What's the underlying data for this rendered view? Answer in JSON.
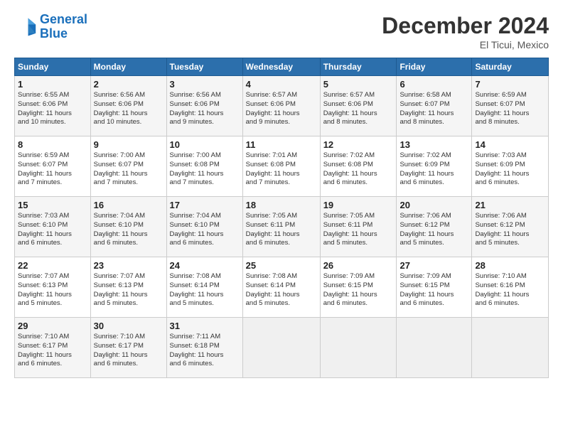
{
  "header": {
    "logo_line1": "General",
    "logo_line2": "Blue",
    "month": "December 2024",
    "location": "El Ticui, Mexico"
  },
  "weekdays": [
    "Sunday",
    "Monday",
    "Tuesday",
    "Wednesday",
    "Thursday",
    "Friday",
    "Saturday"
  ],
  "weeks": [
    [
      {
        "day": "1",
        "info": "Sunrise: 6:55 AM\nSunset: 6:06 PM\nDaylight: 11 hours\nand 10 minutes."
      },
      {
        "day": "2",
        "info": "Sunrise: 6:56 AM\nSunset: 6:06 PM\nDaylight: 11 hours\nand 10 minutes."
      },
      {
        "day": "3",
        "info": "Sunrise: 6:56 AM\nSunset: 6:06 PM\nDaylight: 11 hours\nand 9 minutes."
      },
      {
        "day": "4",
        "info": "Sunrise: 6:57 AM\nSunset: 6:06 PM\nDaylight: 11 hours\nand 9 minutes."
      },
      {
        "day": "5",
        "info": "Sunrise: 6:57 AM\nSunset: 6:06 PM\nDaylight: 11 hours\nand 8 minutes."
      },
      {
        "day": "6",
        "info": "Sunrise: 6:58 AM\nSunset: 6:07 PM\nDaylight: 11 hours\nand 8 minutes."
      },
      {
        "day": "7",
        "info": "Sunrise: 6:59 AM\nSunset: 6:07 PM\nDaylight: 11 hours\nand 8 minutes."
      }
    ],
    [
      {
        "day": "8",
        "info": "Sunrise: 6:59 AM\nSunset: 6:07 PM\nDaylight: 11 hours\nand 7 minutes."
      },
      {
        "day": "9",
        "info": "Sunrise: 7:00 AM\nSunset: 6:07 PM\nDaylight: 11 hours\nand 7 minutes."
      },
      {
        "day": "10",
        "info": "Sunrise: 7:00 AM\nSunset: 6:08 PM\nDaylight: 11 hours\nand 7 minutes."
      },
      {
        "day": "11",
        "info": "Sunrise: 7:01 AM\nSunset: 6:08 PM\nDaylight: 11 hours\nand 7 minutes."
      },
      {
        "day": "12",
        "info": "Sunrise: 7:02 AM\nSunset: 6:08 PM\nDaylight: 11 hours\nand 6 minutes."
      },
      {
        "day": "13",
        "info": "Sunrise: 7:02 AM\nSunset: 6:09 PM\nDaylight: 11 hours\nand 6 minutes."
      },
      {
        "day": "14",
        "info": "Sunrise: 7:03 AM\nSunset: 6:09 PM\nDaylight: 11 hours\nand 6 minutes."
      }
    ],
    [
      {
        "day": "15",
        "info": "Sunrise: 7:03 AM\nSunset: 6:10 PM\nDaylight: 11 hours\nand 6 minutes."
      },
      {
        "day": "16",
        "info": "Sunrise: 7:04 AM\nSunset: 6:10 PM\nDaylight: 11 hours\nand 6 minutes."
      },
      {
        "day": "17",
        "info": "Sunrise: 7:04 AM\nSunset: 6:10 PM\nDaylight: 11 hours\nand 6 minutes."
      },
      {
        "day": "18",
        "info": "Sunrise: 7:05 AM\nSunset: 6:11 PM\nDaylight: 11 hours\nand 6 minutes."
      },
      {
        "day": "19",
        "info": "Sunrise: 7:05 AM\nSunset: 6:11 PM\nDaylight: 11 hours\nand 5 minutes."
      },
      {
        "day": "20",
        "info": "Sunrise: 7:06 AM\nSunset: 6:12 PM\nDaylight: 11 hours\nand 5 minutes."
      },
      {
        "day": "21",
        "info": "Sunrise: 7:06 AM\nSunset: 6:12 PM\nDaylight: 11 hours\nand 5 minutes."
      }
    ],
    [
      {
        "day": "22",
        "info": "Sunrise: 7:07 AM\nSunset: 6:13 PM\nDaylight: 11 hours\nand 5 minutes."
      },
      {
        "day": "23",
        "info": "Sunrise: 7:07 AM\nSunset: 6:13 PM\nDaylight: 11 hours\nand 5 minutes."
      },
      {
        "day": "24",
        "info": "Sunrise: 7:08 AM\nSunset: 6:14 PM\nDaylight: 11 hours\nand 5 minutes."
      },
      {
        "day": "25",
        "info": "Sunrise: 7:08 AM\nSunset: 6:14 PM\nDaylight: 11 hours\nand 5 minutes."
      },
      {
        "day": "26",
        "info": "Sunrise: 7:09 AM\nSunset: 6:15 PM\nDaylight: 11 hours\nand 6 minutes."
      },
      {
        "day": "27",
        "info": "Sunrise: 7:09 AM\nSunset: 6:15 PM\nDaylight: 11 hours\nand 6 minutes."
      },
      {
        "day": "28",
        "info": "Sunrise: 7:10 AM\nSunset: 6:16 PM\nDaylight: 11 hours\nand 6 minutes."
      }
    ],
    [
      {
        "day": "29",
        "info": "Sunrise: 7:10 AM\nSunset: 6:17 PM\nDaylight: 11 hours\nand 6 minutes."
      },
      {
        "day": "30",
        "info": "Sunrise: 7:10 AM\nSunset: 6:17 PM\nDaylight: 11 hours\nand 6 minutes."
      },
      {
        "day": "31",
        "info": "Sunrise: 7:11 AM\nSunset: 6:18 PM\nDaylight: 11 hours\nand 6 minutes."
      },
      null,
      null,
      null,
      null
    ]
  ]
}
